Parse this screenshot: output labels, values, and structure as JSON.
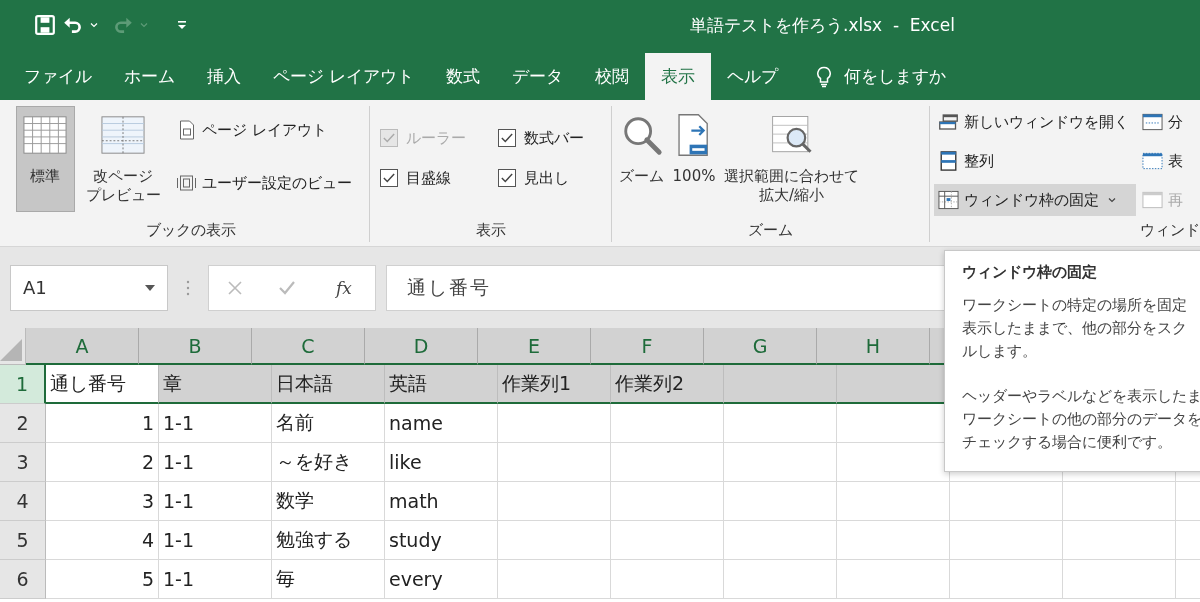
{
  "quick_access": {
    "redo_disabled": true
  },
  "window": {
    "title": "単語テストを作ろう.xlsx  -  Excel"
  },
  "tabs": [
    {
      "label": "ファイル",
      "selected": false
    },
    {
      "label": "ホーム",
      "selected": false
    },
    {
      "label": "挿入",
      "selected": false
    },
    {
      "label": "ページ レイアウト",
      "selected": false
    },
    {
      "label": "数式",
      "selected": false
    },
    {
      "label": "データ",
      "selected": false
    },
    {
      "label": "校閲",
      "selected": false
    },
    {
      "label": "表示",
      "selected": true
    },
    {
      "label": "ヘルプ",
      "selected": false
    }
  ],
  "tell_me": {
    "placeholder": "何をしますか"
  },
  "ribbon": {
    "groups": [
      {
        "label": "ブックの表示",
        "items": [
          {
            "kind": "large",
            "label": [
              "標準"
            ],
            "selected": true
          },
          {
            "kind": "large",
            "label": [
              "改ページ",
              "プレビュー"
            ],
            "selected": false
          },
          {
            "kind": "small",
            "label": "ページ レイアウト",
            "disabled": false
          },
          {
            "kind": "small",
            "label": "ユーザー設定のビュー",
            "disabled": false
          }
        ]
      },
      {
        "label": "表示",
        "items": [
          {
            "kind": "check",
            "label": "ルーラー",
            "checked": true,
            "disabled": true
          },
          {
            "kind": "check",
            "label": "数式バー",
            "checked": true,
            "disabled": false
          },
          {
            "kind": "check",
            "label": "目盛線",
            "checked": true,
            "disabled": false
          },
          {
            "kind": "check",
            "label": "見出し",
            "checked": true,
            "disabled": false
          }
        ]
      },
      {
        "label": "ズーム",
        "items": [
          {
            "kind": "large",
            "label": [
              "ズーム"
            ],
            "selected": false
          },
          {
            "kind": "large",
            "label": [
              "100%"
            ],
            "selected": false
          },
          {
            "kind": "large",
            "label": [
              "選択範囲に合わせて",
              "拡大/縮小"
            ],
            "selected": false
          }
        ]
      },
      {
        "label": "ウィンド",
        "items": [
          {
            "kind": "small",
            "label": "新しいウィンドウを開く",
            "disabled": false,
            "hover": false
          },
          {
            "kind": "small",
            "label": "整列",
            "disabled": false,
            "hover": false
          },
          {
            "kind": "small",
            "label": "ウィンドウ枠の固定",
            "disabled": false,
            "hover": true
          },
          {
            "kind": "small",
            "label": "分",
            "disabled": false,
            "hover": false
          },
          {
            "kind": "small",
            "label": "表",
            "disabled": false,
            "hover": false
          },
          {
            "kind": "small",
            "label": "再",
            "disabled": true,
            "hover": false
          }
        ]
      }
    ]
  },
  "formula_bar": {
    "name_box": "A1",
    "cancel_disabled": true,
    "enter_disabled": true,
    "function_label": "fx",
    "value": "通し番号"
  },
  "sheet": {
    "columns": [
      "A",
      "B",
      "C",
      "D",
      "E",
      "F",
      "G",
      "H"
    ],
    "rows": [
      {
        "header": "1",
        "selected": true,
        "cells": [
          {
            "text": "通し番号",
            "active": true
          },
          {
            "text": "章",
            "active": false
          },
          {
            "text": "日本語",
            "active": false
          },
          {
            "text": "英語",
            "active": false
          },
          {
            "text": "作業列1",
            "active": false
          },
          {
            "text": "作業列2",
            "active": false
          },
          {
            "text": "",
            "active": false
          },
          {
            "text": "",
            "active": false
          }
        ]
      },
      {
        "header": "2",
        "selected": false,
        "cells": [
          "1",
          "1-1",
          "名前",
          "name",
          "",
          "",
          "",
          ""
        ]
      },
      {
        "header": "3",
        "selected": false,
        "cells": [
          "2",
          "1-1",
          "～を好き",
          "like",
          "",
          "",
          "",
          ""
        ]
      },
      {
        "header": "4",
        "selected": false,
        "cells": [
          "3",
          "1-1",
          "数学",
          "math",
          "",
          "",
          "",
          ""
        ]
      },
      {
        "header": "5",
        "selected": false,
        "cells": [
          "4",
          "1-1",
          "勉強する",
          "study",
          "",
          "",
          "",
          ""
        ]
      },
      {
        "header": "6",
        "selected": false,
        "cells": [
          "5",
          "1-1",
          "毎",
          "every",
          "",
          "",
          "",
          ""
        ]
      }
    ]
  },
  "tooltip": {
    "title": "ウィンドウ枠の固定",
    "paragraphs": [
      [
        "ワークシートの特定の場所を固定",
        "表示したままで、他の部分をスク",
        "ルします。"
      ],
      [
        "ヘッダーやラベルなどを表示したま",
        "ワークシートの他の部分のデータを",
        "チェックする場合に便利です。"
      ]
    ]
  }
}
